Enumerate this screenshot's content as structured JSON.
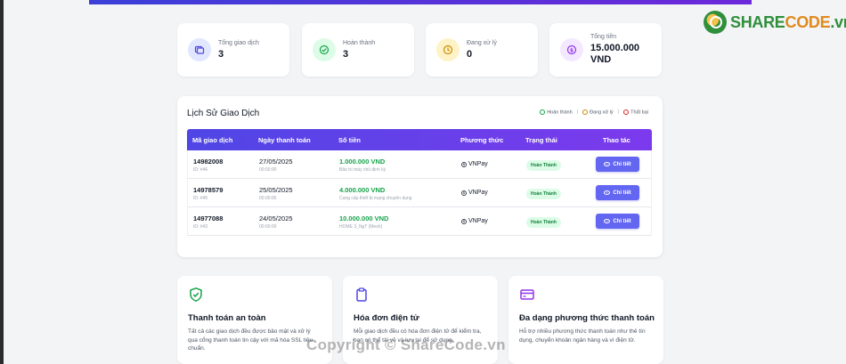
{
  "branding": {
    "logo_part1": "SHARE",
    "logo_part2": "CODE",
    "logo_part3": ".vn"
  },
  "stats": [
    {
      "label": "Tổng giao dịch",
      "value": "3",
      "icon": "receipt-icon",
      "color": "#4f46e5",
      "bg": "#e0e7ff"
    },
    {
      "label": "Hoàn thành",
      "value": "3",
      "icon": "check-circle-icon",
      "color": "#16a34a",
      "bg": "#dcfce7"
    },
    {
      "label": "Đang xử lý",
      "value": "0",
      "icon": "clock-icon",
      "color": "#ca8a04",
      "bg": "#fef3c7"
    },
    {
      "label": "Tổng tiền",
      "value": "15.000.000",
      "value2": "VND",
      "icon": "dollar-icon",
      "color": "#9333ea",
      "bg": "#f3e8ff"
    }
  ],
  "history": {
    "title": "Lịch Sử Giao Dịch",
    "legend": [
      {
        "label": "Hoàn thành",
        "color": "#16a34a"
      },
      {
        "label": "Đang xử lý",
        "color": "#ca8a04"
      },
      {
        "label": "Thất bại",
        "color": "#dc2626"
      }
    ],
    "columns": [
      "Mã giao dịch",
      "Ngày thanh toán",
      "Số tiền",
      "Phương thức",
      "Trạng thái",
      "Thao tác"
    ],
    "rows": [
      {
        "code": "14982008",
        "id": "ID: #46",
        "date": "27/05/2025",
        "time": "00:00:00",
        "amount": "1.000.000 VND",
        "desc": "Bảo trì máy chủ định kỳ",
        "method": "VNPay",
        "status": "Hoàn Thành",
        "action": "Chi tiết"
      },
      {
        "code": "14978579",
        "id": "ID: #45",
        "date": "25/05/2025",
        "time": "00:00:00",
        "amount": "4.000.000 VND",
        "desc": "Cung cấp thiết bị mạng chuyên dụng",
        "method": "VNPay",
        "status": "Hoàn Thành",
        "action": "Chi tiết"
      },
      {
        "code": "14977088",
        "id": "ID: #43",
        "date": "24/05/2025",
        "time": "00:00:00",
        "amount": "10.000.000 VND",
        "desc": "HOME 3_NgT (Mesh)",
        "method": "VNPay",
        "status": "Hoàn Thành",
        "action": "Chi tiết"
      }
    ]
  },
  "features": [
    {
      "title": "Thanh toán an toàn",
      "text": "Tất cả các giao dịch đều được bảo mật và xử lý qua cổng thanh toán tin cậy với mã hóa SSL tiêu chuẩn.",
      "icon": "shield-check-icon",
      "color": "#16a34a"
    },
    {
      "title": "Hóa đơn điện tử",
      "text": "Mỗi giao dịch đều có hóa đơn điện tử để kiểm tra, bạn có thể tải về và lưu lại để sử dụng.",
      "icon": "clipboard-icon",
      "color": "#4f46e5"
    },
    {
      "title": "Đa dạng phương thức thanh toán",
      "text": "Hỗ trợ nhiều phương thức thanh toán như thẻ tín dụng, chuyển khoản ngân hàng và ví điện tử.",
      "icon": "credit-card-icon",
      "color": "#9333ea"
    }
  ],
  "watermark": "Copyright © ShareCode.vn"
}
